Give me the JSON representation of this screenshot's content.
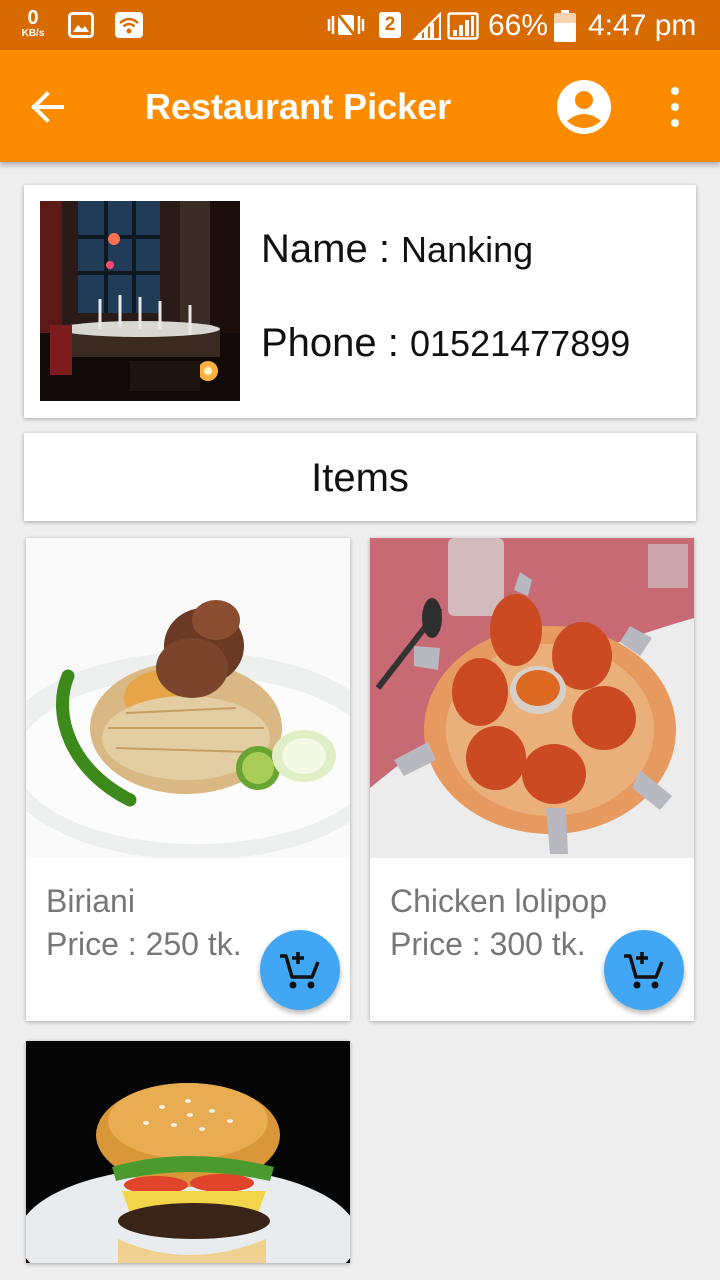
{
  "status_bar": {
    "net_speed": "0",
    "net_speed_unit": "KB/s",
    "sim_slot": "2",
    "battery": "66%",
    "time": "4:47 pm"
  },
  "app_bar": {
    "title": "Restaurant Picker"
  },
  "restaurant": {
    "name_label": "Name : ",
    "name": "Nanking",
    "phone_label": "Phone : ",
    "phone": "01521477899"
  },
  "items_section": {
    "title": "Items"
  },
  "items": [
    {
      "name": "Biriani",
      "price": "Price : 250 tk."
    },
    {
      "name": "Chicken lolipop",
      "price": "Price : 300 tk."
    },
    {
      "name": "",
      "price": ""
    }
  ],
  "colors": {
    "status_bar": "#d76a00",
    "app_bar": "#fc8b00",
    "fab": "#41a6f3",
    "background": "#eeeeee"
  },
  "icons": {
    "back": "arrow-left-icon",
    "account": "account-circle-icon",
    "overflow": "more-vert-icon",
    "cart": "add-shopping-cart-icon"
  }
}
